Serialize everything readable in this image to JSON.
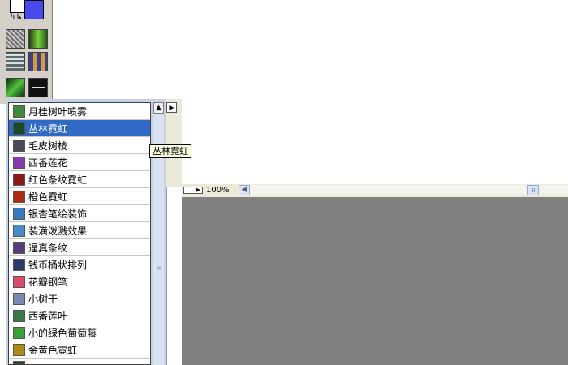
{
  "colors": {
    "foreground_swatch": "#4848ec",
    "background_swatch": "#ffffff",
    "selection": "#316ac5",
    "workspace": "#808080"
  },
  "toolbox": {
    "swap_icon": "swap-colors-icon",
    "brush_tiles": [
      "brush-texture-gray",
      "brush-texture-green",
      "brush-texture-stone",
      "brush-texture-plaid",
      "brush-texture-leaf",
      "brush-texture-black"
    ]
  },
  "brush_list": {
    "selected_index": 1,
    "items": [
      {
        "label": "月桂树叶喷雾",
        "icon": "laurel-leaf-icon",
        "color": "#3f8a3a"
      },
      {
        "label": "丛林霓虹",
        "icon": "jungle-neon-icon",
        "color": "#1b4a2a"
      },
      {
        "label": "毛皮树枝",
        "icon": "fur-branch-icon",
        "color": "#4a4a5a"
      },
      {
        "label": "西番莲花",
        "icon": "passion-flower-icon",
        "color": "#8a3ab0"
      },
      {
        "label": "红色条纹霓虹",
        "icon": "red-stripe-neon-icon",
        "color": "#8a1a1a"
      },
      {
        "label": "橙色霓虹",
        "icon": "orange-neon-icon",
        "color": "#b02a10"
      },
      {
        "label": "银杏笔绘装饰",
        "icon": "ginkgo-icon",
        "color": "#3a7ac0"
      },
      {
        "label": "装潢泼溅效果",
        "icon": "splash-icon",
        "color": "#4a8ac8"
      },
      {
        "label": "逼真条纹",
        "icon": "realistic-stripe-icon",
        "color": "#5a3a7a"
      },
      {
        "label": "钱币桶状排列",
        "icon": "coin-barrel-icon",
        "color": "#2a3a6a"
      },
      {
        "label": "花瓣钢笔",
        "icon": "petal-pen-icon",
        "color": "#e04a6a"
      },
      {
        "label": "小树干",
        "icon": "small-trunk-icon",
        "color": "#7a8ab0"
      },
      {
        "label": "西番莲叶",
        "icon": "passion-leaf-icon",
        "color": "#3a7a4a"
      },
      {
        "label": "小的绿色葡萄藤",
        "icon": "green-vine-icon",
        "color": "#3aa03a"
      },
      {
        "label": "金黄色霓虹",
        "icon": "golden-neon-icon",
        "color": "#b08a10"
      },
      {
        "label": "",
        "icon": "partial-item-icon",
        "color": "#404040"
      }
    ]
  },
  "tooltip": {
    "text": "丛林霓虹"
  },
  "status_bar": {
    "zoom": "100%"
  }
}
